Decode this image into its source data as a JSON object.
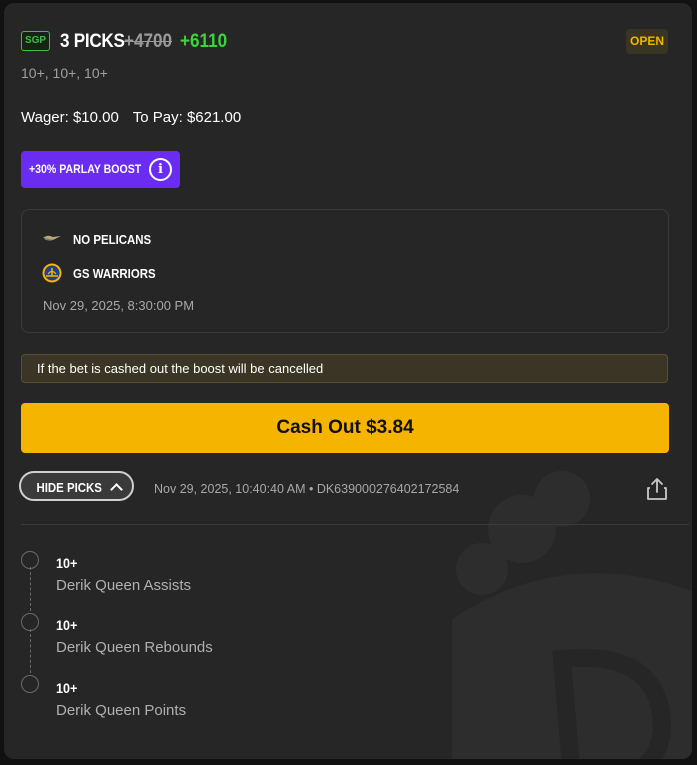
{
  "bet": {
    "badge": "SGP",
    "title": "3 PICKS",
    "old_odds": "+4700",
    "new_odds": "+6110",
    "status": "OPEN",
    "legs_summary": "10+, 10+, 10+",
    "wager": "Wager: $10.00",
    "to_pay": "To Pay: $621.00"
  },
  "boost": {
    "label": "+30% PARLAY BOOST",
    "info_icon": "info-icon"
  },
  "game": {
    "team1": {
      "name": "NO PELICANS",
      "logo": "pelicans-logo-icon"
    },
    "team2": {
      "name": "GS WARRIORS",
      "logo": "warriors-logo-icon"
    },
    "datetime": "Nov 29, 2025, 8:30:00 PM"
  },
  "notice": "If the bet is cashed out the boost will be cancelled",
  "cashout_label": "Cash Out $3.84",
  "toggle_label": "HIDE PICKS",
  "placed_meta": "Nov 29, 2025, 10:40:40 AM • DK639000276402172584",
  "share_icon": "share-icon",
  "picks": [
    {
      "value": "10+",
      "desc": "Derik Queen Assists"
    },
    {
      "value": "10+",
      "desc": "Derik Queen Rebounds"
    },
    {
      "value": "10+",
      "desc": "Derik Queen Points"
    }
  ],
  "colors": {
    "accent_yellow": "#f5b400",
    "boost_purple": "#6a2cf0",
    "odds_green": "#3bd43b",
    "card_bg": "#262626"
  }
}
